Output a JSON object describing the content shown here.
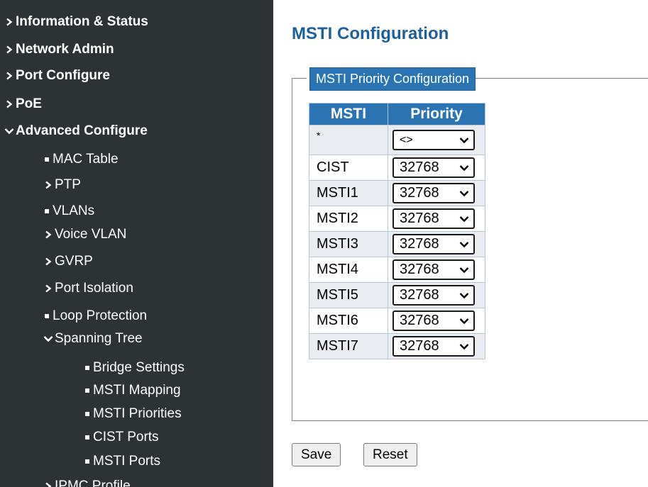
{
  "sidebar": {
    "items": [
      {
        "label": "Information & Status",
        "icon": "chevron-right-icon"
      },
      {
        "label": "Network Admin",
        "icon": "chevron-right-icon"
      },
      {
        "label": "Port Configure",
        "icon": "chevron-right-icon"
      },
      {
        "label": "PoE",
        "icon": "chevron-right-icon"
      },
      {
        "label": "Advanced Configure",
        "icon": "chevron-down-icon"
      },
      {
        "label": "MAC Table",
        "icon": "bullet-icon"
      },
      {
        "label": "PTP",
        "icon": "chevron-right-icon"
      },
      {
        "label": "VLANs",
        "icon": "bullet-icon"
      },
      {
        "label": "Voice VLAN",
        "icon": "chevron-right-icon"
      },
      {
        "label": "GVRP",
        "icon": "chevron-right-icon"
      },
      {
        "label": "Port Isolation",
        "icon": "chevron-right-icon"
      },
      {
        "label": "Loop Protection",
        "icon": "bullet-icon"
      },
      {
        "label": "Spanning Tree",
        "icon": "chevron-down-icon"
      },
      {
        "label": "Bridge Settings",
        "icon": "bullet-icon"
      },
      {
        "label": "MSTI Mapping",
        "icon": "bullet-icon"
      },
      {
        "label": "MSTI Priorities",
        "icon": "bullet-icon"
      },
      {
        "label": "CIST Ports",
        "icon": "bullet-icon"
      },
      {
        "label": "MSTI Ports",
        "icon": "bullet-icon"
      },
      {
        "label": "IPMC Profile",
        "icon": "chevron-right-icon"
      }
    ]
  },
  "main": {
    "title": "MSTI Configuration",
    "fieldset_legend": "MSTI Priority Configuration",
    "table": {
      "headers": [
        "MSTI",
        "Priority"
      ],
      "star_row": {
        "label": "*",
        "value": "<>"
      },
      "rows": [
        {
          "msti": "CIST",
          "priority": "32768"
        },
        {
          "msti": "MSTI1",
          "priority": "32768"
        },
        {
          "msti": "MSTI2",
          "priority": "32768"
        },
        {
          "msti": "MSTI3",
          "priority": "32768"
        },
        {
          "msti": "MSTI4",
          "priority": "32768"
        },
        {
          "msti": "MSTI5",
          "priority": "32768"
        },
        {
          "msti": "MSTI6",
          "priority": "32768"
        },
        {
          "msti": "MSTI7",
          "priority": "32768"
        }
      ]
    },
    "buttons": {
      "save": "Save",
      "reset": "Reset"
    }
  },
  "colors": {
    "sidebar_bg": "#2d3234",
    "title": "#1d5f9a",
    "header_bg": "#2a74b3",
    "row_alt_bg": "#e9ecf1"
  }
}
